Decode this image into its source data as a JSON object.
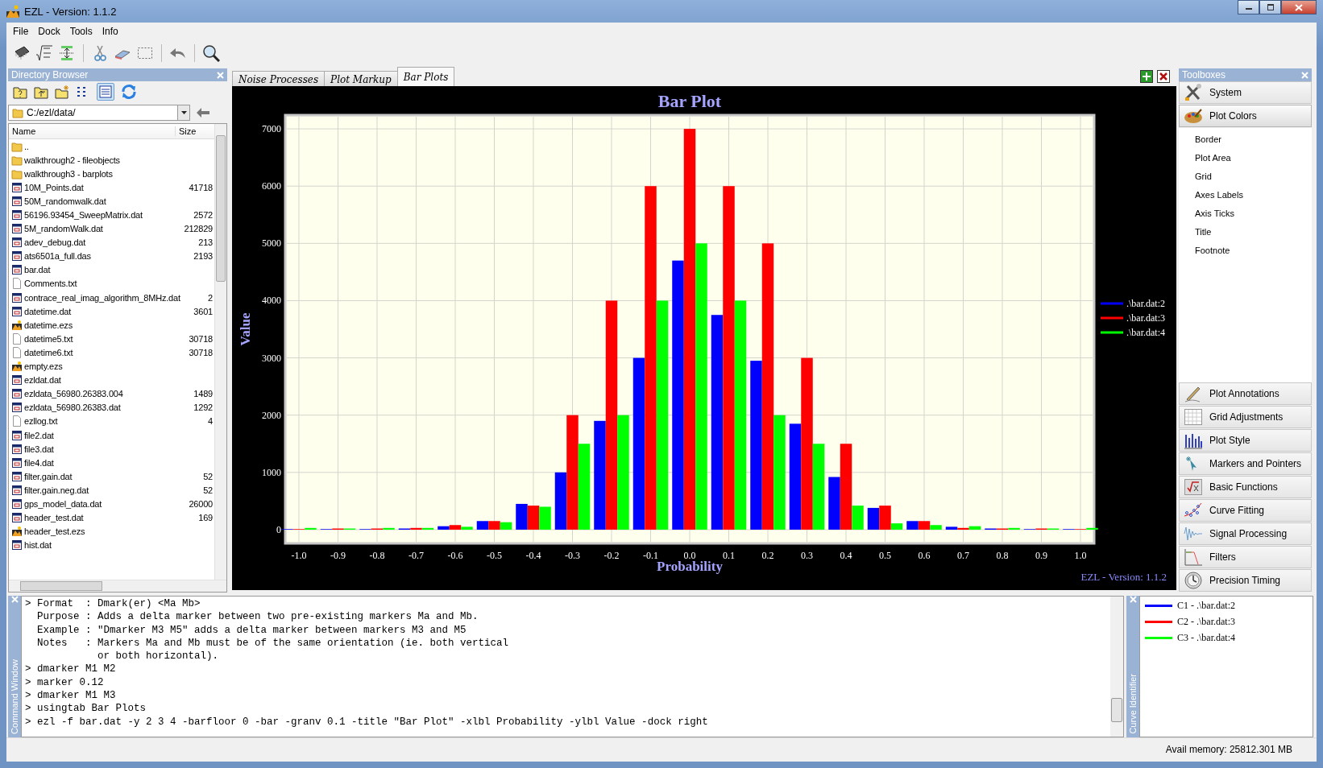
{
  "window": {
    "title": "EZL - Version: 1.1.2"
  },
  "menu": [
    "File",
    "Dock",
    "Tools",
    "Info"
  ],
  "directory_browser": {
    "title": "Directory Browser",
    "path": "C:/ezl/data/",
    "columns": [
      "Name",
      "Size"
    ],
    "files": [
      {
        "name": "..",
        "kind": "folder"
      },
      {
        "name": "walkthrough2 - fileobjects",
        "kind": "folder"
      },
      {
        "name": "walkthrough3 - barplots",
        "kind": "folder"
      },
      {
        "name": "10M_Points.dat",
        "size": "41718",
        "kind": "data"
      },
      {
        "name": "50M_randomwalk.dat",
        "kind": "data"
      },
      {
        "name": "56196.93454_SweepMatrix.dat",
        "size": "2572",
        "kind": "data"
      },
      {
        "name": "5M_randomWalk.dat",
        "size": "212829",
        "kind": "data"
      },
      {
        "name": "adev_debug.dat",
        "size": "213",
        "kind": "data"
      },
      {
        "name": "ats6501a_full.das",
        "size": "2193",
        "kind": "data"
      },
      {
        "name": "bar.dat",
        "kind": "data"
      },
      {
        "name": "Comments.txt",
        "kind": "text"
      },
      {
        "name": "contrace_real_imag_algorithm_8MHz.dat",
        "size": "2",
        "kind": "data"
      },
      {
        "name": "datetime.dat",
        "size": "3601",
        "kind": "data"
      },
      {
        "name": "datetime.ezs",
        "kind": "session"
      },
      {
        "name": "datetime5.txt",
        "size": "30718",
        "kind": "text"
      },
      {
        "name": "datetime6.txt",
        "size": "30718",
        "kind": "text"
      },
      {
        "name": "empty.ezs",
        "kind": "session"
      },
      {
        "name": "ezldat.dat",
        "kind": "data"
      },
      {
        "name": "ezldata_56980.26383.004",
        "size": "1489",
        "kind": "data"
      },
      {
        "name": "ezldata_56980.26383.dat",
        "size": "1292",
        "kind": "data"
      },
      {
        "name": "ezllog.txt",
        "size": "4",
        "kind": "text"
      },
      {
        "name": "file2.dat",
        "kind": "data"
      },
      {
        "name": "file3.dat",
        "kind": "data"
      },
      {
        "name": "file4.dat",
        "kind": "data"
      },
      {
        "name": "filter.gain.dat",
        "size": "52",
        "kind": "data"
      },
      {
        "name": "filter.gain.neg.dat",
        "size": "52",
        "kind": "data"
      },
      {
        "name": "gps_model_data.dat",
        "size": "26000",
        "kind": "data"
      },
      {
        "name": "header_test.dat",
        "size": "169",
        "kind": "data"
      },
      {
        "name": "header_test.ezs",
        "kind": "session"
      },
      {
        "name": "hist.dat",
        "kind": "data"
      }
    ]
  },
  "tabs": [
    {
      "label": "Noise Processes",
      "selected": false
    },
    {
      "label": "Plot Markup",
      "selected": false
    },
    {
      "label": "Bar Plots",
      "selected": true
    }
  ],
  "plot": {
    "footnote": "EZL - Version: 1.1.2",
    "chart_data": {
      "type": "bar",
      "title": "Bar Plot",
      "xlabel": "Probability",
      "ylabel": "Value",
      "x": [
        -1.0,
        -0.9,
        -0.8,
        -0.7,
        -0.6,
        -0.5,
        -0.4,
        -0.3,
        -0.2,
        -0.1,
        0.0,
        0.1,
        0.2,
        0.3,
        0.4,
        0.5,
        0.6,
        0.7,
        0.8,
        0.9,
        1.0
      ],
      "series": [
        {
          "name": ".\\bar.dat:2",
          "color": "#0000ff",
          "values": [
            10,
            10,
            10,
            20,
            60,
            150,
            450,
            1000,
            1900,
            3000,
            4700,
            3750,
            2950,
            1850,
            920,
            380,
            150,
            50,
            20,
            10,
            10
          ]
        },
        {
          "name": ".\\bar.dat:3",
          "color": "#ff0000",
          "values": [
            10,
            20,
            20,
            30,
            80,
            150,
            420,
            2000,
            4000,
            6000,
            7000,
            6000,
            5000,
            3000,
            1500,
            420,
            150,
            30,
            20,
            20,
            10
          ]
        },
        {
          "name": ".\\bar.dat:4",
          "color": "#00ff00",
          "values": [
            30,
            20,
            30,
            30,
            50,
            130,
            400,
            1500,
            2000,
            4000,
            5000,
            4000,
            2000,
            1500,
            420,
            110,
            80,
            60,
            30,
            20,
            30
          ]
        }
      ],
      "grid": true,
      "legend": true,
      "xlim": [
        -1.035,
        1.035
      ],
      "ylim": [
        -240,
        7240
      ],
      "xticks": [
        {
          "value": -1.0,
          "label": "-1.0"
        },
        {
          "value": -0.9,
          "label": "-0.9"
        },
        {
          "value": -0.8,
          "label": "-0.8"
        },
        {
          "value": -0.7,
          "label": "-0.7"
        },
        {
          "value": -0.6,
          "label": "-0.6"
        },
        {
          "value": -0.5,
          "label": "-0.5"
        },
        {
          "value": -0.4,
          "label": "-0.4"
        },
        {
          "value": -0.3,
          "label": "-0.3"
        },
        {
          "value": -0.2,
          "label": "-0.2"
        },
        {
          "value": -0.1,
          "label": "-0.1"
        },
        {
          "value": 0.0,
          "label": "0.0"
        },
        {
          "value": 0.1,
          "label": "0.1"
        },
        {
          "value": 0.2,
          "label": "0.2"
        },
        {
          "value": 0.3,
          "label": "0.3"
        },
        {
          "value": 0.4,
          "label": "0.4"
        },
        {
          "value": 0.5,
          "label": "0.5"
        },
        {
          "value": 0.6,
          "label": "0.6"
        },
        {
          "value": 0.7,
          "label": "0.7"
        },
        {
          "value": 0.8,
          "label": "0.8"
        },
        {
          "value": 0.9,
          "label": "0.9"
        },
        {
          "value": 1.0,
          "label": "1.0"
        }
      ],
      "yticks": [
        0,
        1000,
        2000,
        3000,
        4000,
        5000,
        6000,
        7000
      ]
    }
  },
  "toolboxes": {
    "title": "Toolboxes",
    "sections": [
      {
        "label": "System",
        "expanded": false
      },
      {
        "label": "Plot Colors",
        "expanded": true,
        "items": [
          "Border",
          "Plot Area",
          "Grid",
          "Axes Labels",
          "Axis Ticks",
          "Title",
          "Footnote"
        ]
      },
      {
        "label": "Plot Annotations",
        "expanded": false
      },
      {
        "label": "Grid Adjustments",
        "expanded": false
      },
      {
        "label": "Plot Style",
        "expanded": false
      },
      {
        "label": "Markers and Pointers",
        "expanded": false
      },
      {
        "label": "Basic Functions",
        "expanded": false
      },
      {
        "label": "Curve Fitting",
        "expanded": false
      },
      {
        "label": "Signal Processing",
        "expanded": false
      },
      {
        "label": "Filters",
        "expanded": false
      },
      {
        "label": "Precision Timing",
        "expanded": false
      }
    ]
  },
  "command_window": {
    "title": "Command Window",
    "lines": [
      "> Format  : Dmark(er) <Ma Mb>",
      "  Purpose : Adds a delta marker between two pre-existing markers Ma and Mb.",
      "  Example : \"Dmarker M3 M5\" adds a delta marker between markers M3 and M5",
      "  Notes   : Markers Ma and Mb must be of the same orientation (ie. both vertical",
      "            or both horizontal).",
      "> dmarker M1 M2",
      "> marker 0.12",
      "> dmarker M1 M3",
      "> usingtab Bar Plots",
      "> ezl -f bar.dat -y 2 3 4 -barfloor 0 -bar -granv 0.1 -title \"Bar Plot\" -xlbl Probability -ylbl Value -dock right"
    ]
  },
  "curve_identifier": {
    "title": "Curve Identifier",
    "curves": [
      {
        "label": "C1 - .\\bar.dat:2",
        "color": "#0000ff"
      },
      {
        "label": "C2 - .\\bar.dat:3",
        "color": "#ff0000"
      },
      {
        "label": "C3 - .\\bar.dat:4",
        "color": "#00ff00"
      }
    ]
  },
  "status_bar": {
    "memory": "Avail memory: 25812.301 MB"
  }
}
